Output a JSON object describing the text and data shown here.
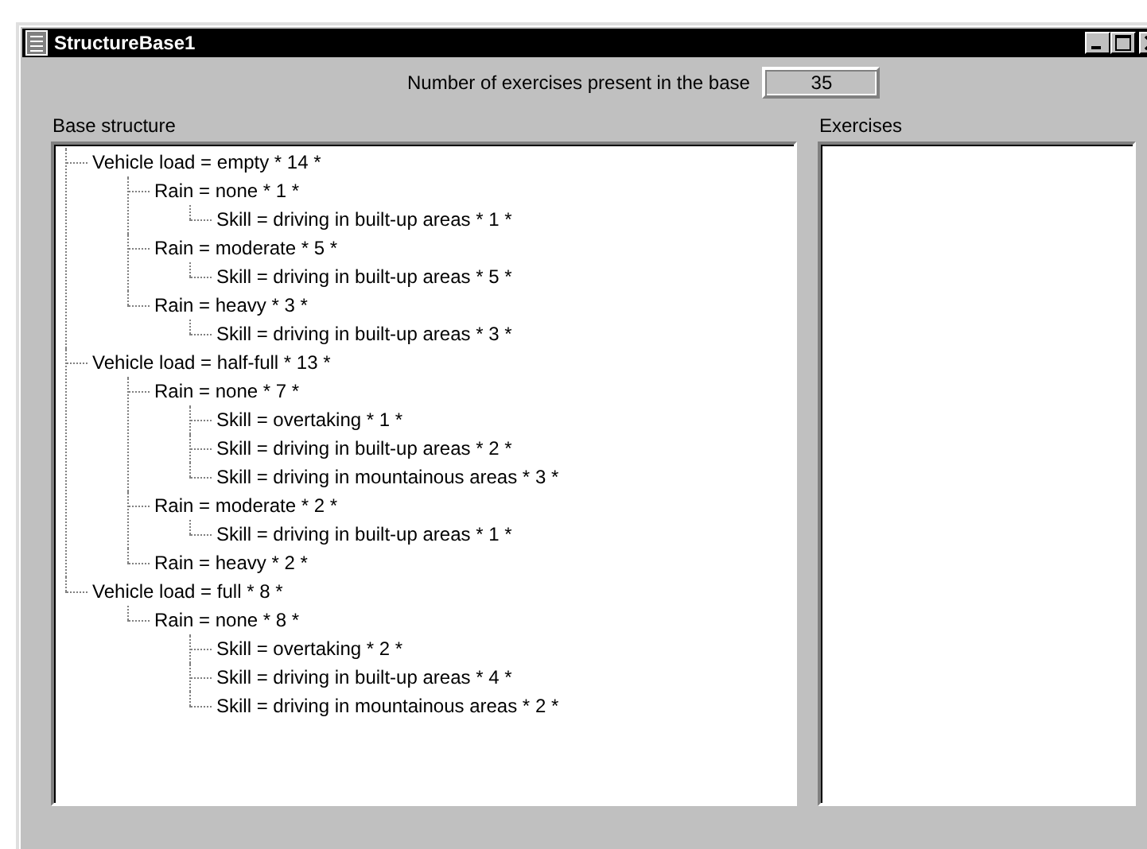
{
  "window": {
    "title": "StructureBase1"
  },
  "count": {
    "label": "Number of exercises present in the base",
    "value": "35"
  },
  "base_structure": {
    "label": "Base structure",
    "tree": [
      {
        "text": "Vehicle load = empty * 14 *",
        "children": [
          {
            "text": "Rain = none * 1 *",
            "children": [
              {
                "text": "Skill = driving in built-up areas * 1 *"
              }
            ]
          },
          {
            "text": "Rain = moderate * 5 *",
            "children": [
              {
                "text": "Skill = driving in built-up areas * 5 *"
              }
            ]
          },
          {
            "text": "Rain = heavy * 3 *",
            "children": [
              {
                "text": "Skill = driving in built-up areas * 3 *"
              }
            ]
          }
        ]
      },
      {
        "text": "Vehicle load = half-full * 13 *",
        "children": [
          {
            "text": "Rain = none * 7 *",
            "children": [
              {
                "text": "Skill = overtaking * 1 *"
              },
              {
                "text": "Skill = driving in built-up areas * 2 *"
              },
              {
                "text": "Skill = driving in mountainous areas * 3 *"
              }
            ]
          },
          {
            "text": "Rain = moderate * 2 *",
            "children": [
              {
                "text": "Skill = driving in built-up areas * 1 *"
              }
            ]
          },
          {
            "text": "Rain = heavy * 2 *"
          }
        ]
      },
      {
        "text": "Vehicle load = full * 8 *",
        "children": [
          {
            "text": "Rain = none * 8 *",
            "children": [
              {
                "text": "Skill = overtaking * 2 *"
              },
              {
                "text": "Skill = driving in built-up areas * 4 *"
              },
              {
                "text": "Skill = driving in mountainous areas * 2 *"
              }
            ]
          }
        ]
      }
    ]
  },
  "exercises": {
    "label": "Exercises"
  }
}
